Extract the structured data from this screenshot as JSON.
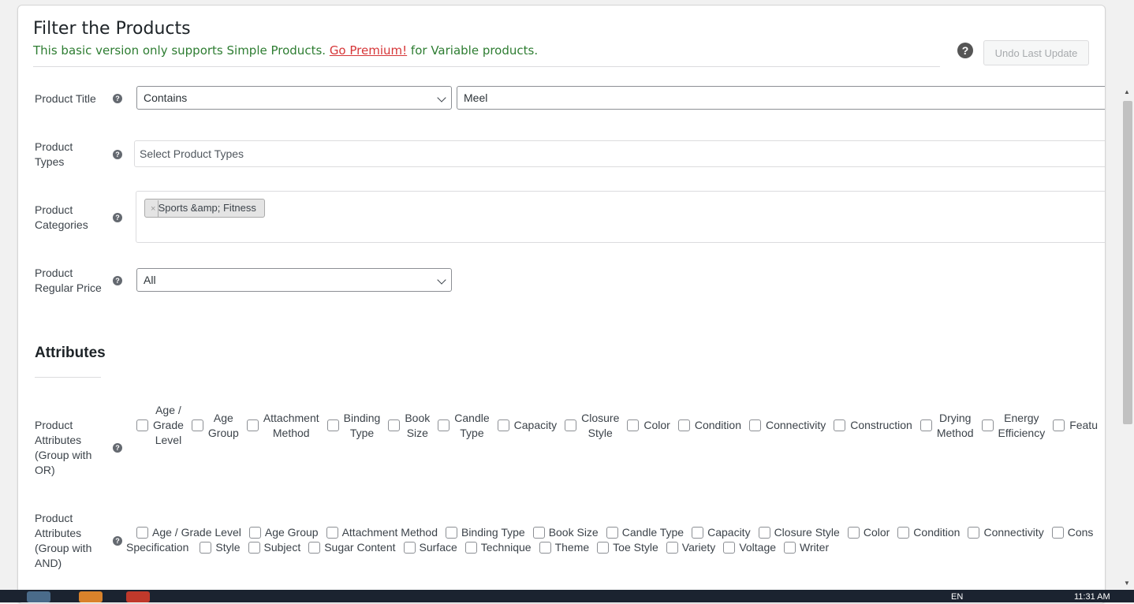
{
  "header": {
    "title": "Filter the Products",
    "notice_prefix": "This basic version only supports Simple Products.",
    "notice_link": "Go Premium!",
    "notice_suffix": "for Variable products.",
    "help_glyph": "?",
    "undo_label": "Undo Last Update"
  },
  "fields": {
    "product_title": {
      "label": "Product Title",
      "operator": "Contains",
      "value": "Meel"
    },
    "product_types": {
      "label": "Product Types",
      "placeholder": "Select Product Types"
    },
    "product_categories": {
      "label": "Product Categories",
      "tag": "Sports &amp; Fitness",
      "tag_remove": "×"
    },
    "regular_price": {
      "label": "Product Regular Price",
      "value": "All"
    }
  },
  "attributes": {
    "heading": "Attributes",
    "or_label": "Product Attributes (Group with OR)",
    "or_items": [
      "Age / Grade Level",
      "Age Group",
      "Attachment Method",
      "Binding Type",
      "Book Size",
      "Candle Type",
      "Capacity",
      "Closure Style",
      "Color",
      "Condition",
      "Connectivity",
      "Construction",
      "Drying Method",
      "Energy Efficiency",
      "Featu"
    ],
    "and_label": "Product Attributes (Group with AND)",
    "and_items_row1": [
      "Age / Grade Level",
      "Age Group",
      "Attachment Method",
      "Binding Type",
      "Book Size",
      "Candle Type",
      "Capacity",
      "Closure Style",
      "Color",
      "Condition",
      "Connectivity",
      "Cons"
    ],
    "and_row2_lead": "Specification",
    "and_items_row2": [
      "Style",
      "Subject",
      "Sugar Content",
      "Surface",
      "Technique",
      "Theme",
      "Toe Style",
      "Variety",
      "Voltage",
      "Writer"
    ]
  },
  "taskbar": {
    "time": "11:31 AM",
    "lang": "EN"
  },
  "colors": {
    "notice": "#2e7d32",
    "link": "#d63638",
    "help": "#646970"
  }
}
